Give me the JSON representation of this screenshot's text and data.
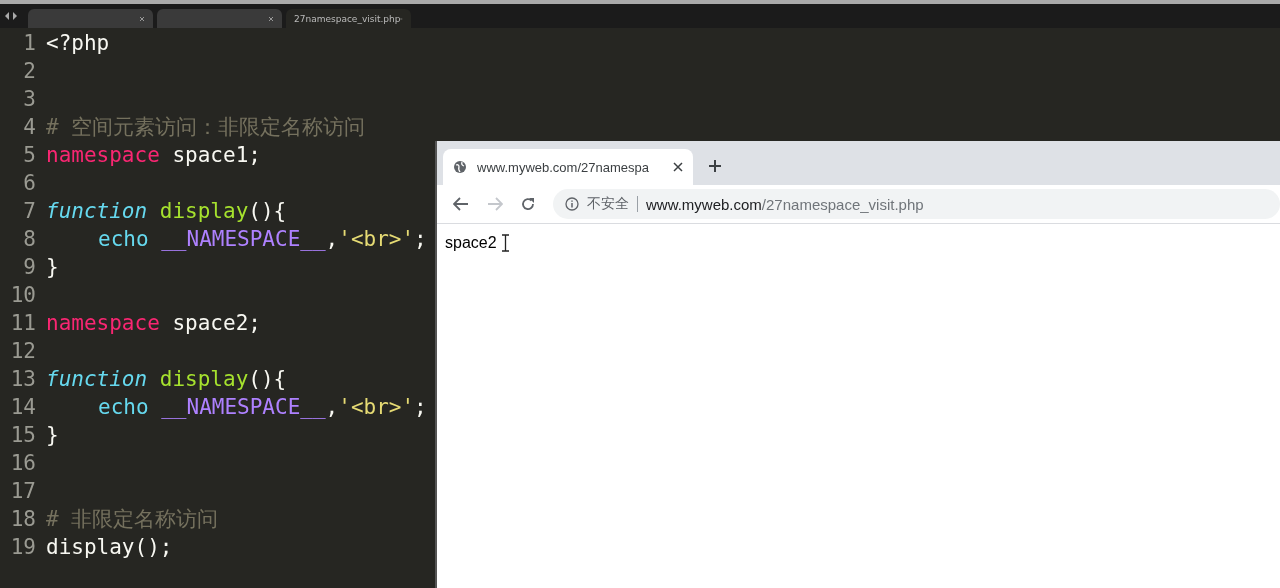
{
  "editor": {
    "tabs": [
      {
        "selected": false
      },
      {
        "selected": false
      },
      {
        "label": "27namespace_visit.php",
        "selected": true
      }
    ],
    "lines": [
      {
        "number": "1",
        "tokens": [
          {
            "kind": "plain",
            "text": "<?php"
          }
        ]
      },
      {
        "number": "2"
      },
      {
        "number": "3"
      },
      {
        "number": "4",
        "tokens": [
          {
            "kind": "comment",
            "text": "# 空间元素访问：非限定名称访问"
          }
        ]
      },
      {
        "number": "5",
        "tokens": [
          {
            "kind": "keyword",
            "text": "namespace"
          },
          {
            "kind": "plain",
            "text": " space1;"
          }
        ]
      },
      {
        "number": "6"
      },
      {
        "number": "7",
        "tokens": [
          {
            "kind": "storage",
            "text": "function "
          },
          {
            "kind": "entity",
            "text": "display"
          },
          {
            "kind": "plain",
            "text": "(){"
          }
        ]
      },
      {
        "number": "8",
        "indent": true,
        "tokens": [
          {
            "kind": "support",
            "text": "echo "
          },
          {
            "kind": "constant",
            "text": "__NAMESPACE__"
          },
          {
            "kind": "plain",
            "text": ","
          },
          {
            "kind": "string",
            "text": "'<br>'"
          },
          {
            "kind": "plain",
            "text": ";"
          }
        ]
      },
      {
        "number": "9",
        "tokens": [
          {
            "kind": "plain",
            "text": "}"
          }
        ]
      },
      {
        "number": "10"
      },
      {
        "number": "11",
        "tokens": [
          {
            "kind": "keyword",
            "text": "namespace"
          },
          {
            "kind": "plain",
            "text": " space2;"
          }
        ]
      },
      {
        "number": "12"
      },
      {
        "number": "13",
        "tokens": [
          {
            "kind": "storage",
            "text": "function "
          },
          {
            "kind": "entity",
            "text": "display"
          },
          {
            "kind": "plain",
            "text": "(){"
          }
        ]
      },
      {
        "number": "14",
        "indent": true,
        "tokens": [
          {
            "kind": "support",
            "text": "echo "
          },
          {
            "kind": "constant",
            "text": "__NAMESPACE__"
          },
          {
            "kind": "plain",
            "text": ","
          },
          {
            "kind": "string",
            "text": "'<br>'"
          },
          {
            "kind": "plain",
            "text": ";"
          }
        ]
      },
      {
        "number": "15",
        "tokens": [
          {
            "kind": "plain",
            "text": "}"
          }
        ]
      },
      {
        "number": "16"
      },
      {
        "number": "17"
      },
      {
        "number": "18",
        "tokens": [
          {
            "kind": "comment",
            "text": "# 非限定名称访问"
          }
        ]
      },
      {
        "number": "19",
        "tokens": [
          {
            "kind": "plain",
            "text": "display();"
          }
        ]
      }
    ]
  },
  "browser": {
    "tab": {
      "title": "www.myweb.com/27namespa"
    },
    "toolbar": {
      "security": "不安全",
      "url_host": "www.myweb.com",
      "url_path": "/27namespace_visit.php",
      "forward_disabled": true
    },
    "content": {
      "text": "space2"
    }
  }
}
